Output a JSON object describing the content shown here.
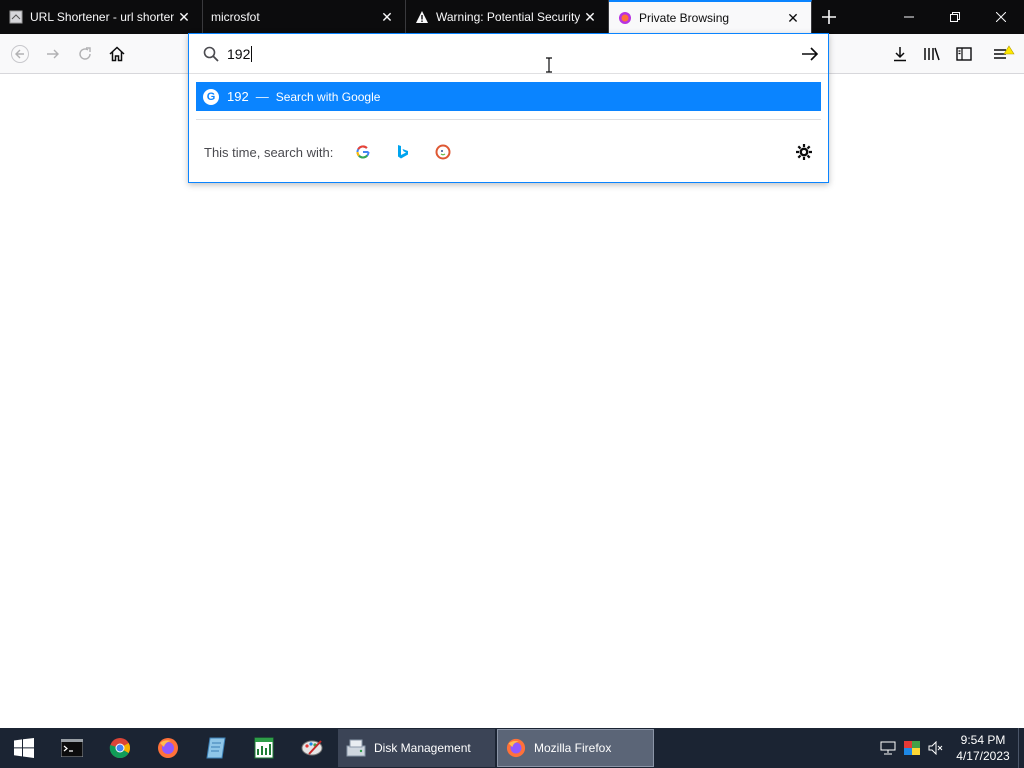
{
  "tabs": [
    {
      "title": "URL Shortener - url shorten",
      "icon": "page-icon"
    },
    {
      "title": "microsfot",
      "icon": "none"
    },
    {
      "title": "Warning: Potential Security",
      "icon": "warning-icon"
    },
    {
      "title": "Private Browsing",
      "icon": "firefox-private-icon",
      "active": true
    }
  ],
  "urlbar": {
    "value": "192",
    "result": {
      "query": "192",
      "separator": "—",
      "action": "Search with Google"
    },
    "oneoff_label": "This time, search with:",
    "engines": [
      "Google",
      "Bing",
      "DuckDuckGo"
    ]
  },
  "taskbar": {
    "apps": [
      {
        "label": "Disk Management"
      },
      {
        "label": "Mozilla Firefox"
      }
    ],
    "clock": {
      "time": "9:54 PM",
      "date": "4/17/2023"
    }
  },
  "colors": {
    "accent": "#0a84ff",
    "tabstrip": "#0c0c0d",
    "taskbar": "#1b2433"
  }
}
